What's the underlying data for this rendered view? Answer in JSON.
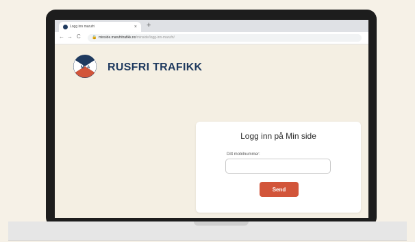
{
  "browser": {
    "tab_title": "Logg inn marufri",
    "tab_close": "×",
    "new_tab": "+",
    "nav_back": "←",
    "nav_forward": "→",
    "nav_reload": "C",
    "url_host": "minside.marufritrafikk.no",
    "url_path": "/minside/logg-inn-marufri/"
  },
  "header": {
    "brand": "RUSFRI TRAFIKK",
    "logo_letters": "M A"
  },
  "login": {
    "title": "Logg inn på Min side",
    "phone_label": "Ditt mobilnummer:",
    "phone_value": "",
    "send_label": "Send"
  },
  "colors": {
    "brand_navy": "#1f3a5f",
    "accent_red": "#d2553a",
    "page_background": "#f4efe3"
  }
}
